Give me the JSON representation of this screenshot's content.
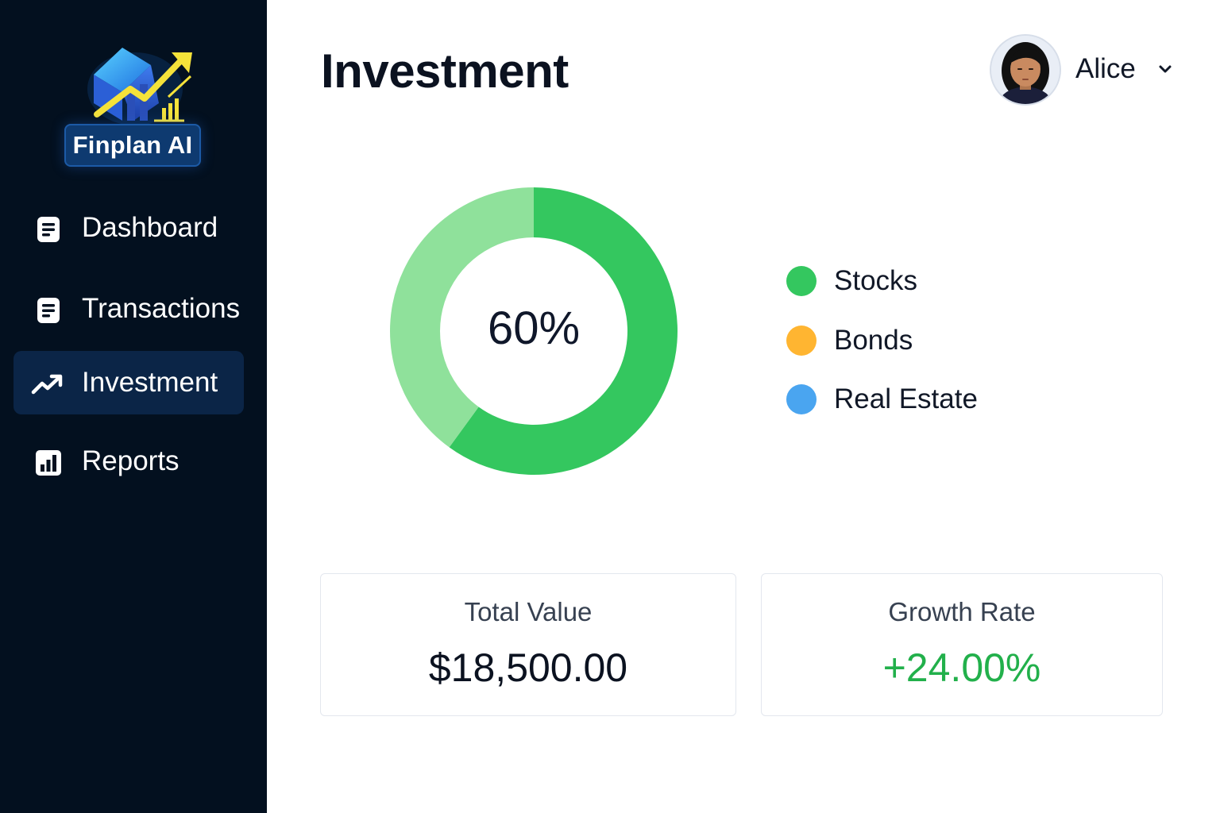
{
  "brand": {
    "name": "Finplan AI",
    "badge_bg": "#0e3a70"
  },
  "sidebar": {
    "items": [
      {
        "label": "Dashboard",
        "icon": "document-icon",
        "active": false
      },
      {
        "label": "Transactions",
        "icon": "document-icon",
        "active": false
      },
      {
        "label": "Investment",
        "icon": "trending-up-icon",
        "active": true
      },
      {
        "label": "Reports",
        "icon": "bar-chart-icon",
        "active": false
      }
    ]
  },
  "header": {
    "title": "Investment"
  },
  "user": {
    "name": "Alice",
    "menu_icon": "chevron-down-icon"
  },
  "chart_data": {
    "type": "pie",
    "center_label": "60%",
    "segments": [
      {
        "value": 60,
        "color": "#34c75f"
      },
      {
        "value": 40,
        "color": "#8fe19b"
      }
    ],
    "legend": [
      {
        "name": "Stocks",
        "color": "#34c75f"
      },
      {
        "name": "Bonds",
        "color": "#ffb531"
      },
      {
        "name": "Real Estate",
        "color": "#4aa5f0"
      }
    ]
  },
  "stats": {
    "total_value": {
      "label": "Total Value",
      "value": "$18,500.00"
    },
    "growth_rate": {
      "label": "Growth Rate",
      "value": "+24.00%",
      "color": "#22b04b"
    }
  }
}
